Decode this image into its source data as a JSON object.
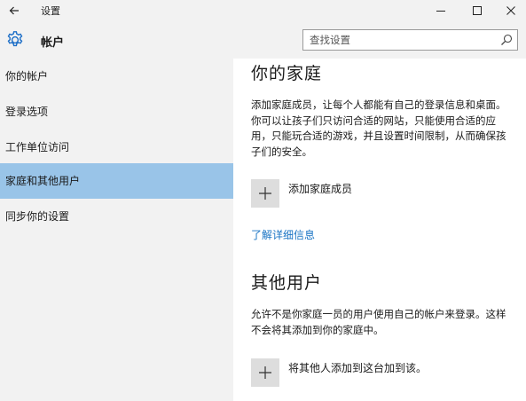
{
  "window": {
    "title": "设置"
  },
  "header": {
    "page_title": "帐户",
    "search_placeholder": "查找设置"
  },
  "sidebar": {
    "items": [
      {
        "label": "你的帐户"
      },
      {
        "label": "登录选项"
      },
      {
        "label": "工作单位访问"
      },
      {
        "label": "家庭和其他用户",
        "active": true
      },
      {
        "label": "同步你的设置"
      }
    ]
  },
  "main": {
    "family": {
      "heading": "你的家庭",
      "description": "添加家庭成员，让每个人都能有自己的登录信息和桌面。你可以让孩子们只访问合适的网站，只能使用合适的应用，只能玩合适的游戏，并且设置时间限制，从而确保孩子们的安全。",
      "add_label": "添加家庭成员",
      "learn_more": "了解详细信息"
    },
    "others": {
      "heading": "其他用户",
      "description": "允许不是你家庭一员的用户使用自己的帐户来登录。这样不会将其添加到你的家庭中。",
      "add_label": "将其他人添加到这台加到该。"
    }
  },
  "colors": {
    "active_item": "#99c4e8",
    "link": "#1a74c4",
    "accent_icon": "#1e6fc7"
  }
}
